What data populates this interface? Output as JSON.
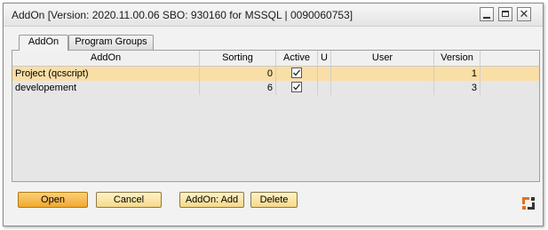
{
  "window": {
    "title": "AddOn [Version: 2020.11.00.06 SBO: 930160 for MSSQL | 0090060753]",
    "controls": {
      "minimize": "minimize-icon",
      "maximize": "maximize-icon",
      "close": "close-icon",
      "close_glyph": "✕"
    }
  },
  "tabs": [
    {
      "label": "AddOn",
      "active": true
    },
    {
      "label": "Program Groups",
      "active": false
    }
  ],
  "table": {
    "columns": [
      "AddOn",
      "Sorting",
      "Active",
      "U",
      "User",
      "Version"
    ],
    "rows": [
      {
        "addon": "Project (qcscript)",
        "sorting": "0",
        "active": true,
        "u": "",
        "user": "",
        "version": "1",
        "selected": true
      },
      {
        "addon": "developement",
        "sorting": "6",
        "active": true,
        "u": "",
        "user": "",
        "version": "3",
        "selected": false
      }
    ]
  },
  "buttons": {
    "open": "Open",
    "cancel": "Cancel",
    "add": "AddOn: Add",
    "delete": "Delete"
  },
  "colors": {
    "selected_row": "#f9dea5",
    "primary_button": "#f2a830",
    "button": "#f6d98a",
    "corner_icon": "#e07020"
  }
}
